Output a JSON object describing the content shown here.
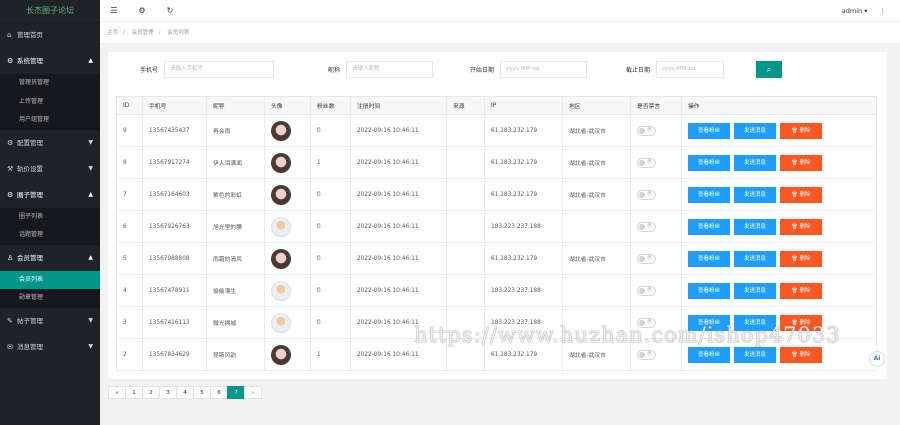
{
  "app": {
    "title": "长杰圈子论坛"
  },
  "sidebar": {
    "items": [
      {
        "label": "管理首页",
        "icon": "home-icon"
      },
      {
        "label": "系统管理",
        "icon": "gear-icon",
        "open": true,
        "children": [
          {
            "label": "管理员管理"
          },
          {
            "label": "上传管理"
          },
          {
            "label": "用户组管理"
          }
        ]
      },
      {
        "label": "配置管理",
        "icon": "gear-icon"
      },
      {
        "label": "轨价设置",
        "icon": "settings-icon"
      },
      {
        "label": "圈子管理",
        "icon": "gear-icon",
        "open": true,
        "children": [
          {
            "label": "圈子列表"
          },
          {
            "label": "话题管理"
          }
        ]
      },
      {
        "label": "会员管理",
        "icon": "user-icon",
        "open": true,
        "children": [
          {
            "label": "会员列表",
            "active": true
          },
          {
            "label": "勋章管理"
          }
        ]
      },
      {
        "label": "帖子管理",
        "icon": "post-icon"
      },
      {
        "label": "消息管理",
        "icon": "message-icon"
      }
    ]
  },
  "topbar": {
    "user": "admin"
  },
  "breadcrumb": [
    "主页",
    "会员管理",
    "会员列表"
  ],
  "search": {
    "phone_label": "手机号",
    "phone_placeholder": "请输入手机号",
    "nick_label": "昵称",
    "nick_placeholder": "请输入昵称",
    "start_label": "开始日期",
    "start_placeholder": "yyyy-MM-dd",
    "end_label": "截止日期",
    "end_placeholder": "yyyy-MM-dd"
  },
  "table": {
    "headers": [
      "ID",
      "手机号",
      "昵称",
      "头像",
      "粉丝数",
      "注册时间",
      "来源",
      "IP",
      "地区",
      "是否禁言",
      "操作"
    ],
    "toggle_label": "否",
    "actions": {
      "fans": "查看粉丝",
      "message": "发送消息",
      "delete": "删除"
    },
    "rows": [
      {
        "id": "9",
        "phone": "13567435437",
        "nick": "再会雨",
        "avatar": "girl",
        "fans": "0",
        "time": "2022-09-16 10:46:11",
        "source": "",
        "ip": "61.183.232.179",
        "region": "湖北省-武汉市"
      },
      {
        "id": "8",
        "phone": "13567917274",
        "nick": "伊人泪满面",
        "avatar": "girl",
        "fans": "1",
        "time": "2022-09-16 10:46:11",
        "source": "",
        "ip": "61.183.232.179",
        "region": "湖北省-武汉市"
      },
      {
        "id": "7",
        "phone": "13567164603",
        "nick": "紫色的彩虹",
        "avatar": "girl",
        "fans": "0",
        "time": "2022-09-16 10:46:11",
        "source": "",
        "ip": "61.183.232.179",
        "region": "湖北省-武汉市"
      },
      {
        "id": "6",
        "phone": "13567926763",
        "nick": "旭光里的腰",
        "avatar": "cartoon",
        "fans": "0",
        "time": "2022-09-16 10:46:11",
        "source": "",
        "ip": "183.223.237.188",
        "region": ""
      },
      {
        "id": "5",
        "phone": "13567988808",
        "nick": "雨霜的清风",
        "avatar": "girl",
        "fans": "0",
        "time": "2022-09-16 10:46:11",
        "source": "",
        "ip": "61.183.232.179",
        "region": "湖北省-武汉市"
      },
      {
        "id": "4",
        "phone": "13567478911",
        "nick": "偷偷漂生",
        "avatar": "cartoon",
        "fans": "0",
        "time": "2022-09-16 10:46:11",
        "source": "",
        "ip": "183.223.237.188",
        "region": ""
      },
      {
        "id": "3",
        "phone": "13567416113",
        "nick": "微光拥城",
        "avatar": "cartoon",
        "fans": "0",
        "time": "2022-09-16 10:46:11",
        "source": "",
        "ip": "183.223.237.188",
        "region": ""
      },
      {
        "id": "2",
        "phone": "13567834629",
        "nick": "昆斯风韵",
        "avatar": "girl",
        "fans": "1",
        "time": "2022-09-16 10:46:11",
        "source": "",
        "ip": "61.183.232.179",
        "region": "湖北省-武汉市"
      }
    ]
  },
  "pager": {
    "prev": "«",
    "pages": [
      "1",
      "2",
      "3",
      "4",
      "5",
      "6",
      "7"
    ],
    "current": "7",
    "next": "›"
  },
  "watermark": "https://www.huzhan.com/ishop47033",
  "ai_badge": "Ai"
}
